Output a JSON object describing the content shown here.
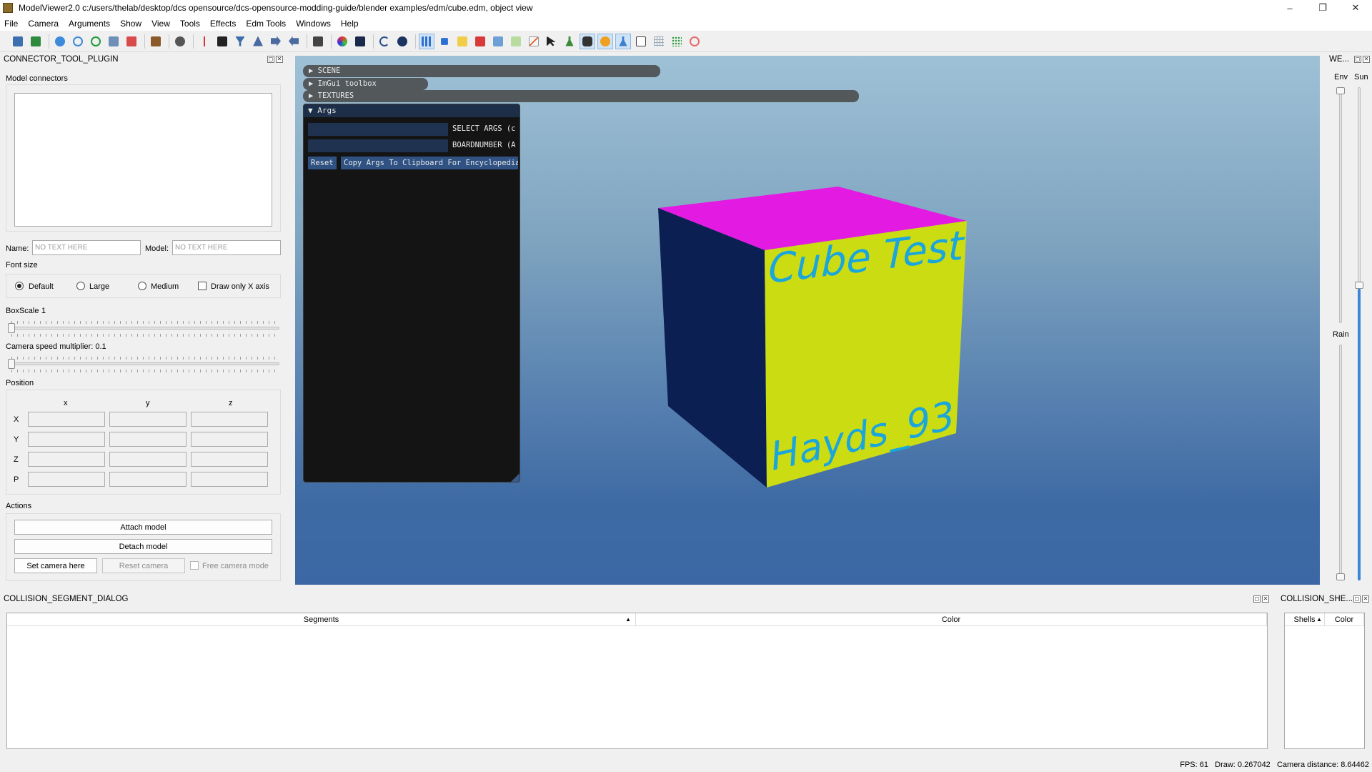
{
  "window": {
    "title": "ModelViewer2.0 c:/users/thelab/desktop/dcs opensource/dcs-opensource-modding-guide/blender examples/edm/cube.edm, object view",
    "minimize": "–",
    "maximize": "❐",
    "close": "✕"
  },
  "menu": [
    "File",
    "Camera",
    "Arguments",
    "Show",
    "View",
    "Tools",
    "Effects",
    "Edm Tools",
    "Windows",
    "Help"
  ],
  "connector_plugin": {
    "title": "CONNECTOR_TOOL_PLUGIN",
    "model_connectors_label": "Model connectors",
    "name_label": "Name:",
    "name_placeholder": "NO TEXT HERE",
    "model_label": "Model:",
    "model_placeholder": "NO TEXT HERE",
    "font_size_label": "Font size",
    "font_options": [
      "Default",
      "Large",
      "Medium"
    ],
    "font_selected": "Default",
    "draw_only_x_label": "Draw only X axis",
    "boxscale_label": "BoxScale",
    "boxscale_value": "1",
    "camera_speed_label": "Camera speed multiplier: 0.1",
    "position_label": "Position",
    "axis_headers": [
      "x",
      "y",
      "z"
    ],
    "row_labels": [
      "X",
      "Y",
      "Z",
      "P"
    ],
    "actions_label": "Actions",
    "attach_label": "Attach model",
    "detach_label": "Detach model",
    "set_camera_label": "Set camera here",
    "reset_camera_label": "Reset camera",
    "free_camera_label": "Free camera mode"
  },
  "imgui": {
    "scene": "SCENE",
    "toolbox": "ImGui toolbox",
    "textures": "TEXTURES",
    "args_title": "Args",
    "select_args": "SELECT ARGS (c",
    "boardnumber": "BOARDNUMBER (A",
    "reset": "Reset",
    "copy_args": "Copy Args To Clipboard For Encyclopedia"
  },
  "cube": {
    "front_text_top": "Cube Test",
    "front_text_bottom": "Hayds_93",
    "top_color": "#e21ae2",
    "front_color": "#cbdc12",
    "side_color": "#0c1f52",
    "text_color": "#1aa6dc"
  },
  "weather": {
    "title": "WE...",
    "env_label": "Env",
    "sun_label": "Sun",
    "rain_label": "Rain",
    "env_level": 1.0,
    "sun_level": 0.6,
    "rain_level": 0.0
  },
  "collision": {
    "title": "COLLISION_SEGMENT_DIALOG",
    "columns": [
      "Segments",
      "Color"
    ]
  },
  "shells": {
    "title": "COLLISION_SHE...",
    "columns": [
      "Shells",
      "Color"
    ]
  },
  "status": {
    "text": "FPS: 61   Draw: 0.267042   Camera distance: 8.64462"
  }
}
